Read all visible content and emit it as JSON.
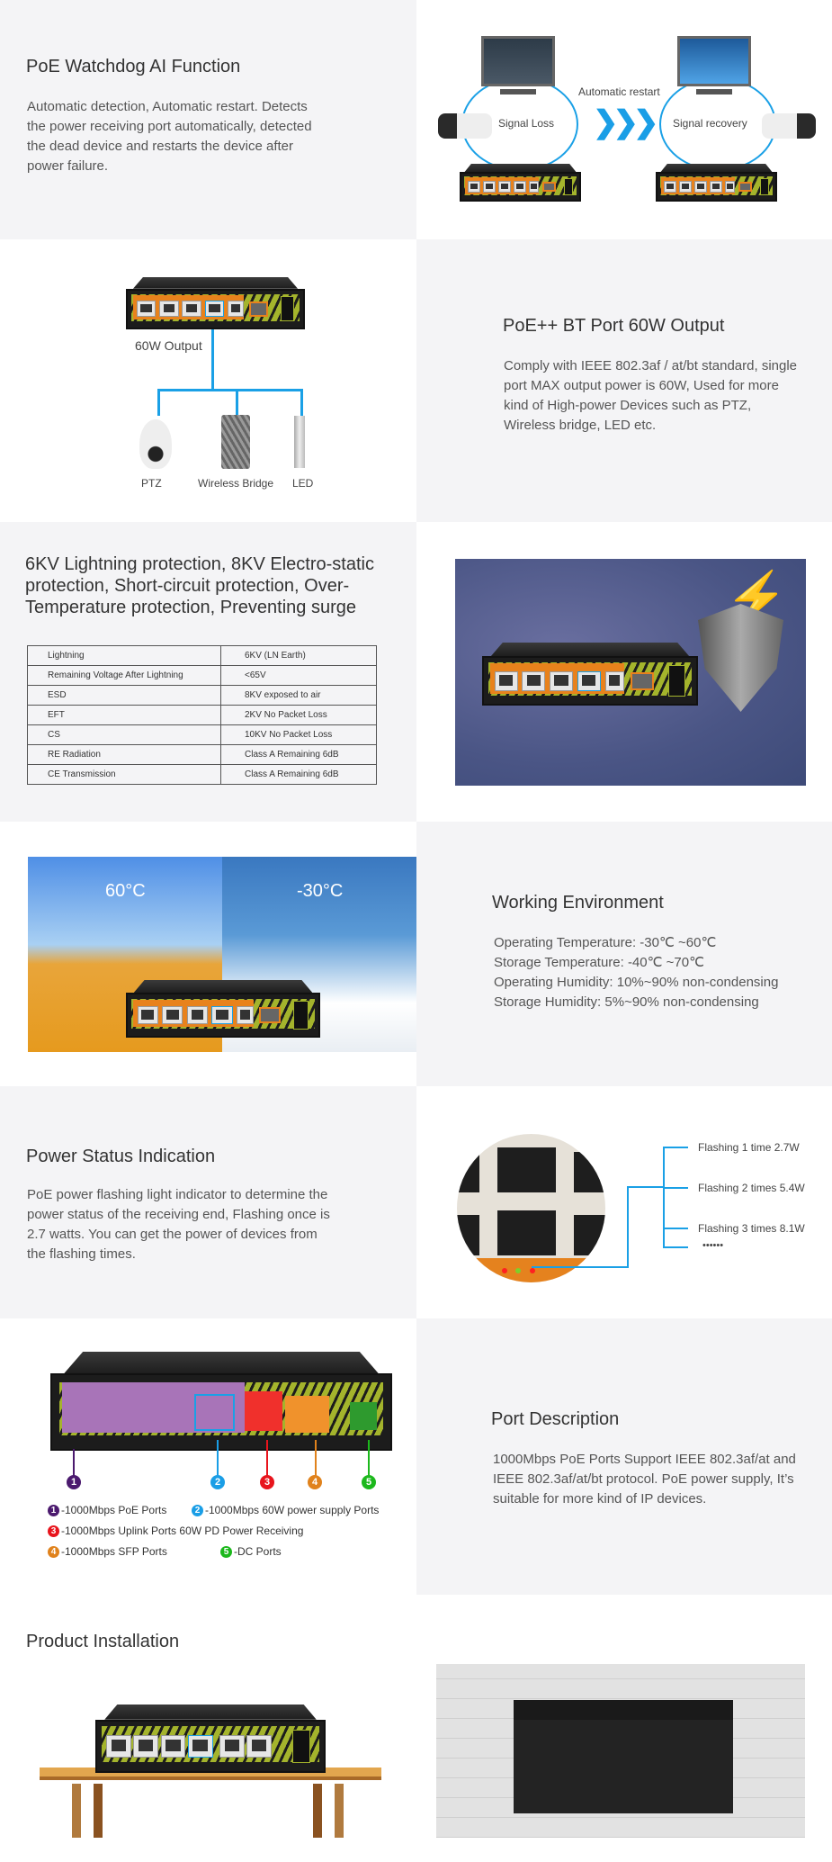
{
  "sections": {
    "watchdog": {
      "title": "PoE Watchdog AI Function",
      "body": "Automatic detection, Automatic restart. Detects the power receiving port automatically, detected the dead device and restarts the device after power failure.",
      "diagram": {
        "left_label": "Signal Loss",
        "middle_label": "Automatic restart",
        "right_label": "Signal recovery"
      }
    },
    "bt_port": {
      "title": "PoE++ BT Port 60W Output",
      "body": "Comply with IEEE 802.3af / at/bt standard, single port MAX output power is 60W, Used for more kind of High-power Devices such as PTZ, Wireless bridge, LED etc.",
      "diagram": {
        "output_label": "60W Output",
        "devices": [
          "PTZ",
          "Wireless Bridge",
          "LED"
        ]
      }
    },
    "protection": {
      "title": "6KV Lightning protection, 8KV Electro-static protection, Short-circuit protection, Over-Temperature protection, Preventing surge",
      "table": [
        [
          "Lightning",
          "6KV (LN Earth)"
        ],
        [
          "Remaining Voltage After Lightning",
          "<65V"
        ],
        [
          "ESD",
          "8KV exposed to air"
        ],
        [
          "EFT",
          "2KV No Packet Loss"
        ],
        [
          "CS",
          "10KV No Packet Loss"
        ],
        [
          "RE Radiation",
          "Class A Remaining 6dB"
        ],
        [
          "CE Transmission",
          "Class A Remaining 6dB"
        ]
      ]
    },
    "environment": {
      "hot_label": "60°C",
      "cold_label": "-30°C",
      "title": "Working Environment",
      "lines": [
        "Operating Temperature: -30℃ ~60℃",
        "Storage Temperature: -40℃ ~70℃",
        "Operating Humidity: 10%~90% non-condensing",
        "Storage Humidity: 5%~90% non-condensing"
      ]
    },
    "power_status": {
      "title": "Power Status Indication",
      "body": "PoE power flashing light indicator to determine the power status of the receiving end, Flashing once is 2.7 watts. You can get the power of devices from the flashing times.",
      "flash_items": [
        "Flashing 1 time 2.7W",
        "Flashing 2 times 5.4W",
        "Flashing 3 times 8.1W",
        "••••••"
      ]
    },
    "ports": {
      "title": "Port Description",
      "body": "1000Mbps PoE Ports Support IEEE 802.3af/at and IEEE 802.3af/at/bt protocol. PoE power supply, It’s suitable for more kind of IP devices.",
      "legend": [
        {
          "num": "1",
          "color": "#4b1a6e",
          "text": "-1000Mbps PoE Ports"
        },
        {
          "num": "2",
          "color": "#1a9ee6",
          "text": "-1000Mbps 60W power supply Ports"
        },
        {
          "num": "3",
          "color": "#e8141c",
          "text": "-1000Mbps Uplink Ports 60W PD Power Receiving"
        },
        {
          "num": "4",
          "color": "#e0821c",
          "text": "-1000Mbps SFP Ports"
        },
        {
          "num": "5",
          "color": "#1cb81c",
          "text": "-DC Ports"
        }
      ]
    },
    "installation": {
      "title": "Product Installation"
    }
  },
  "colors": {
    "accent_blue": "#1aa0e6",
    "panel_gray": "#f4f4f6",
    "switch_orange": "#e8821c",
    "switch_green": "#a4b42c"
  }
}
